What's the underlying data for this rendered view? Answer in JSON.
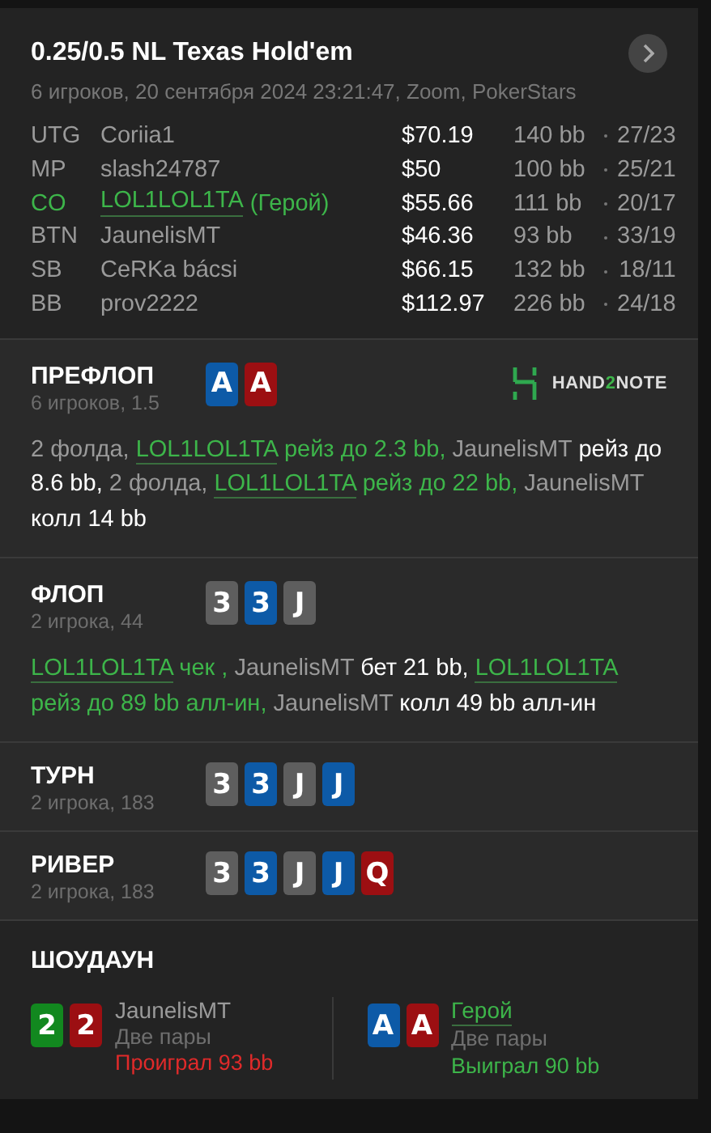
{
  "header": {
    "title": "0.25/0.5 NL Texas Hold'em",
    "subtitle": "6 игроков, 20 сентября 2024 23:21:47, Zoom, PokerStars"
  },
  "players": [
    {
      "position": "UTG",
      "name": "Coriia1",
      "hero": false,
      "stack": "$70.19",
      "bb": "140 bb",
      "stats": "27/23"
    },
    {
      "position": "MP",
      "name": "slash24787",
      "hero": false,
      "stack": "$50",
      "bb": "100 bb",
      "stats": "25/21"
    },
    {
      "position": "CO",
      "name": "LOL1LOL1TA",
      "hero": true,
      "hero_tag": "(Герой)",
      "stack": "$55.66",
      "bb": "111 bb",
      "stats": "20/17"
    },
    {
      "position": "BTN",
      "name": "JaunelisMT",
      "hero": false,
      "stack": "$46.36",
      "bb": "93 bb",
      "stats": "33/19"
    },
    {
      "position": "SB",
      "name": "CeRKa bácsi",
      "hero": false,
      "stack": "$66.15",
      "bb": "132 bb",
      "stats": "18/11"
    },
    {
      "position": "BB",
      "name": "prov2222",
      "hero": false,
      "stack": "$112.97",
      "bb": "226 bb",
      "stats": "24/18"
    }
  ],
  "streets": [
    {
      "name": "ПРЕФЛОП",
      "info": "6 игроков, 1.5",
      "logo_parts": [
        "HAND",
        "2",
        "NOTE"
      ],
      "cards": [
        {
          "rank": "A",
          "color": "#0d5aa7"
        },
        {
          "rank": "A",
          "color": "#9c0f12"
        }
      ],
      "actions": [
        {
          "kind": "player",
          "text": "2 фолда, "
        },
        {
          "kind": "hero",
          "text": "LOL1LOL1TA"
        },
        {
          "kind": "hero_action",
          "text": " рейз до 2.3 bb, "
        },
        {
          "kind": "player",
          "text": "JaunelisMT "
        },
        {
          "kind": "action",
          "text": "рейз до 8.6 bb, "
        },
        {
          "kind": "player",
          "text": "2 фолда, "
        },
        {
          "kind": "hero",
          "text": "LOL1LOL1TA"
        },
        {
          "kind": "hero_action",
          "text": " рейз до 22 bb, "
        },
        {
          "kind": "player",
          "text": "JaunelisMT "
        },
        {
          "kind": "action",
          "text": "колл 14 bb"
        }
      ]
    },
    {
      "name": "ФЛОП",
      "info": "2 игрока, 44",
      "cards": [
        {
          "rank": "3",
          "color": "#5e5e5e"
        },
        {
          "rank": "3",
          "color": "#0d5aa7"
        },
        {
          "rank": "J",
          "color": "#5e5e5e"
        }
      ],
      "actions": [
        {
          "kind": "hero",
          "text": "LOL1LOL1TA"
        },
        {
          "kind": "hero_action",
          "text": " чек , "
        },
        {
          "kind": "player",
          "text": "JaunelisMT "
        },
        {
          "kind": "action",
          "text": "бет 21 bb, "
        },
        {
          "kind": "hero",
          "text": "LOL1LOL1TA"
        },
        {
          "kind": "hero_action",
          "text": " рейз до 89 bb алл-ин, "
        },
        {
          "kind": "player",
          "text": "JaunelisMT "
        },
        {
          "kind": "action",
          "text": "колл 49 bb алл-ин"
        }
      ]
    },
    {
      "name": "ТУРН",
      "info": "2 игрока, 183",
      "cards": [
        {
          "rank": "3",
          "color": "#5e5e5e"
        },
        {
          "rank": "3",
          "color": "#0d5aa7"
        },
        {
          "rank": "J",
          "color": "#5e5e5e"
        },
        {
          "rank": "J",
          "color": "#0d5aa7"
        }
      ]
    },
    {
      "name": "РИВЕР",
      "info": "2 игрока, 183",
      "cards": [
        {
          "rank": "3",
          "color": "#5e5e5e"
        },
        {
          "rank": "3",
          "color": "#0d5aa7"
        },
        {
          "rank": "J",
          "color": "#5e5e5e"
        },
        {
          "rank": "J",
          "color": "#0d5aa7"
        },
        {
          "rank": "Q",
          "color": "#9c0f12"
        }
      ]
    }
  ],
  "showdown": {
    "title": "ШОУДАУН",
    "hands": [
      {
        "name": "JaunelisMT",
        "hero": false,
        "hand": "Две пары",
        "result": "Проиграл 93 bb",
        "won": false,
        "cards": [
          {
            "rank": "2",
            "color": "#12881f"
          },
          {
            "rank": "2",
            "color": "#9c0f12"
          }
        ]
      },
      {
        "name": "Герой",
        "hero": true,
        "hand": "Две пары",
        "result": "Выиграл 90 bb",
        "won": true,
        "cards": [
          {
            "rank": "A",
            "color": "#0d5aa7"
          },
          {
            "rank": "A",
            "color": "#9c0f12"
          }
        ]
      }
    ]
  }
}
